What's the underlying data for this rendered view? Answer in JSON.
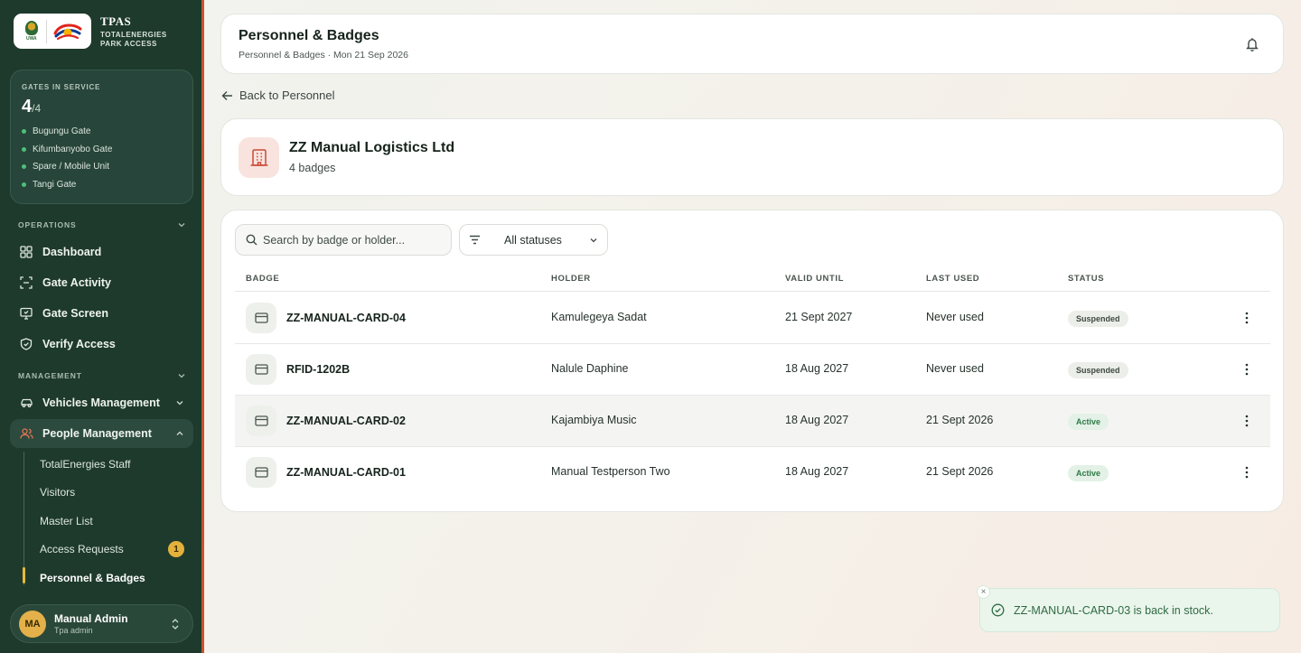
{
  "brand": {
    "name": "TPAS",
    "subtitle_line1": "TOTALENERGIES",
    "subtitle_line2": "PARK ACCESS",
    "uwa_text": "UWA"
  },
  "gates": {
    "label": "GATES IN SERVICE",
    "in_service": "4",
    "total": "/4",
    "list": [
      "Bugungu Gate",
      "Kifumbanyobo Gate",
      "Spare / Mobile Unit",
      "Tangi Gate"
    ]
  },
  "nav": {
    "operations_label": "OPERATIONS",
    "management_label": "MANAGEMENT",
    "operations": [
      {
        "label": "Dashboard",
        "icon": "grid-icon"
      },
      {
        "label": "Gate Activity",
        "icon": "scan-icon"
      },
      {
        "label": "Gate Screen",
        "icon": "monitor-icon"
      },
      {
        "label": "Verify Access",
        "icon": "shield-check-icon"
      }
    ],
    "vehicles": "Vehicles Management",
    "people": "People Management",
    "people_sub": [
      {
        "label": "TotalEnergies Staff"
      },
      {
        "label": "Visitors"
      },
      {
        "label": "Master List"
      },
      {
        "label": "Access Requests",
        "count": "1"
      },
      {
        "label": "Personnel & Badges"
      }
    ]
  },
  "user": {
    "initials": "MA",
    "name": "Manual Admin",
    "role": "Tpa admin"
  },
  "header": {
    "title": "Personnel & Badges",
    "subtitle": "Personnel & Badges · Mon 21 Sep 2026"
  },
  "back_label": "Back to Personnel",
  "company": {
    "name": "ZZ Manual Logistics Ltd",
    "badge_count": "4 badges"
  },
  "filters": {
    "search_placeholder": "Search by badge or holder...",
    "status_selected": "All statuses"
  },
  "table": {
    "columns": [
      "BADGE",
      "HOLDER",
      "VALID UNTIL",
      "LAST USED",
      "STATUS"
    ],
    "rows": [
      {
        "badge": "ZZ-MANUAL-CARD-04",
        "holder": "Kamulegeya Sadat",
        "valid_until": "21 Sept 2027",
        "last_used": "Never used",
        "status": "Suspended"
      },
      {
        "badge": "RFID-1202B",
        "holder": "Nalule Daphine",
        "valid_until": "18 Aug 2027",
        "last_used": "Never used",
        "status": "Suspended"
      },
      {
        "badge": "ZZ-MANUAL-CARD-02",
        "holder": "Kajambiya Music",
        "valid_until": "18 Aug 2027",
        "last_used": "21 Sept 2026",
        "status": "Active"
      },
      {
        "badge": "ZZ-MANUAL-CARD-01",
        "holder": "Manual Testperson Two",
        "valid_until": "18 Aug 2027",
        "last_used": "21 Sept 2026",
        "status": "Active"
      }
    ]
  },
  "toast": {
    "message": "ZZ-MANUAL-CARD-03 is back in stock.",
    "close": "×"
  },
  "colors": {
    "sidebar_bg": "#1e3a2c",
    "accent_orange": "#c9532c",
    "active_green": "#2e7a46",
    "badge_yellow": "#e2b13d"
  }
}
